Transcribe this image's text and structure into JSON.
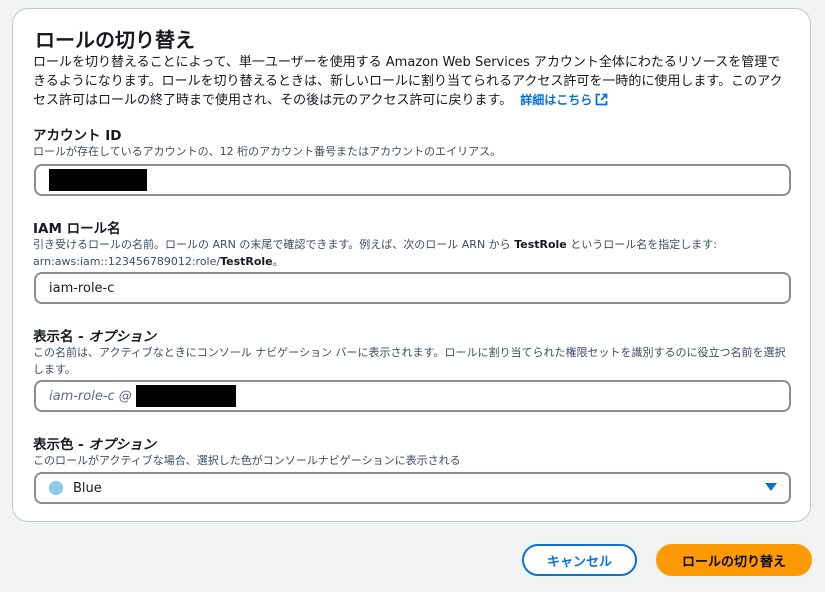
{
  "panel": {
    "title": "ロールの切り替え",
    "description": "ロールを切り替えることによって、単一ユーザーを使用する Amazon Web Services アカウント全体にわたるリソースを管理できるようになります。ロールを切り替えるときは、新しいロールに割り当てられるアクセス許可を一時的に使用します。このアクセス許可はロールの終了時まで使用され、その後は元のアクセス許可に戻ります。",
    "details_link": "詳細はこちら"
  },
  "account_id": {
    "label": "アカウント ID",
    "hint": "ロールが存在しているアカウントの、12 桁のアカウント番号またはアカウントのエイリアス。"
  },
  "iam_role": {
    "label": "IAM ロール名",
    "hint_1": "引き受けるロールの名前。ロールの ARN の末尾で確認できます。例えば、次のロール ARN から ",
    "hint_bold_1": "TestRole",
    "hint_2": " というロール名を指定します: arn:aws:iam::123456789012:role/",
    "hint_bold_2": "TestRole",
    "hint_3": "。",
    "value": "iam-role-c"
  },
  "display_name": {
    "label": "表示名",
    "optional": " - オプション",
    "hint": "この名前は、アクティブなときにコンソール ナビゲーション バーに表示されます。ロールに割り当てられた権限セットを識別するのに役立つ名前を選択します。",
    "placeholder": "iam-role-c @"
  },
  "display_color": {
    "label": "表示色",
    "optional": " - オプション",
    "hint": "このロールがアクティブな場合、選択した色がコンソールナビゲーションに表示される",
    "selected": "Blue",
    "swatch_color": "#88cce8"
  },
  "buttons": {
    "cancel": "キャンセル",
    "switch": "ロールの切り替え"
  },
  "colors": {
    "primary": "#ff9900",
    "link": "#0972d3"
  }
}
